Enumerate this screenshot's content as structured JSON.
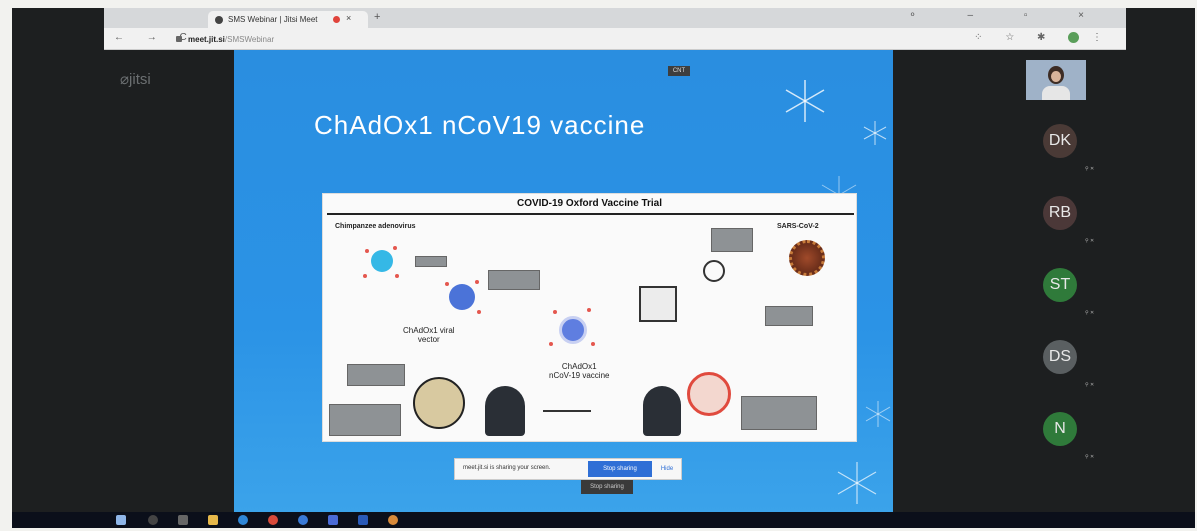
{
  "browser": {
    "tab_title": "SMS Webinar | Jitsi Meet",
    "tab_close": "×",
    "new_tab": "+",
    "window_controls": "⚬ – ▫ ×",
    "nav_buttons": "← → C",
    "url_host": "meet.jit.si",
    "url_path": "/SMSWebinar",
    "extensions": "⁘ ☆ ✱"
  },
  "jitsi": {
    "logo": "⌀jitsi"
  },
  "slide": {
    "badge": "CNT",
    "title": "ChAdOx1 nCoV19 vaccine",
    "diagram": {
      "title": "COVID-19 Oxford Vaccine Trial",
      "chimp_label": "Chimpanzee adenovirus",
      "sars_label": "SARS-CoV-2",
      "viral_vector_label": "ChAdOx1 viral\nvector",
      "vaccine_label": "ChAdOx1\nnCoV-19 vaccine"
    }
  },
  "share_bar": {
    "message": "meet.jit.si is sharing your screen.",
    "stop_label": "Stop sharing",
    "hide_label": "Hide",
    "tooltip": "Stop sharing"
  },
  "participants": [
    {
      "initials": "DK",
      "color": "#4a3a36"
    },
    {
      "initials": "RB",
      "color": "#4b3838"
    },
    {
      "initials": "ST",
      "color": "#2f7a3a"
    },
    {
      "initials": "DS",
      "color": "#5a5f61"
    },
    {
      "initials": "N",
      "color": "#2f7a3a"
    }
  ]
}
